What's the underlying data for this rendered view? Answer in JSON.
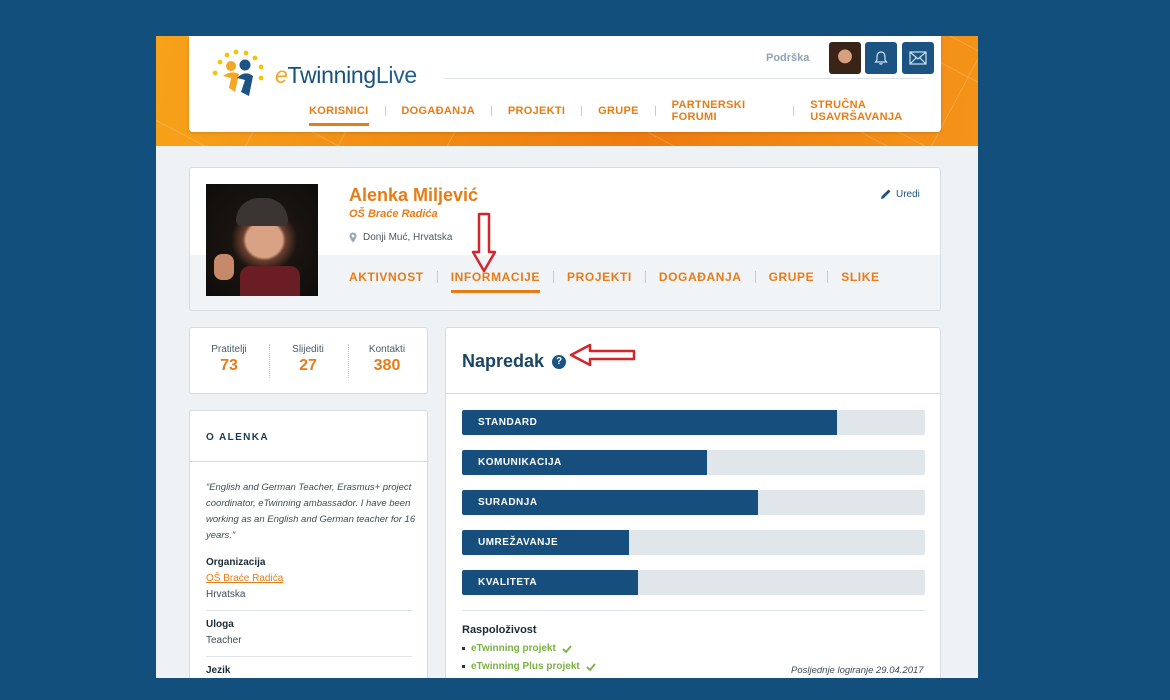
{
  "brand": {
    "logo_e": "e",
    "logo_twinning": "Twinning",
    "logo_live": "Live"
  },
  "header": {
    "support_label": "Podrška",
    "nav": [
      {
        "label": "KORISNICI",
        "active": true
      },
      {
        "label": "DOGAĐANJA"
      },
      {
        "label": "PROJEKTI"
      },
      {
        "label": "GRUPE"
      },
      {
        "label": "PARTNERSKI FORUMI"
      },
      {
        "label": "STRUČNA USAVRŠAVANJA"
      }
    ]
  },
  "profile": {
    "name": "Alenka Miljević",
    "school": "OŠ Braće Radića",
    "location": "Donji Muć, Hrvatska",
    "edit_label": "Uredi",
    "tabs": [
      {
        "label": "AKTIVNOST"
      },
      {
        "label": "INFORMACIJE",
        "active": true
      },
      {
        "label": "PROJEKTI"
      },
      {
        "label": "DOGAĐANJA"
      },
      {
        "label": "GRUPE"
      },
      {
        "label": "SLIKE"
      }
    ]
  },
  "stats": [
    {
      "label": "Pratitelji",
      "value": "73"
    },
    {
      "label": "Slijediti",
      "value": "27"
    },
    {
      "label": "Kontakti",
      "value": "380"
    }
  ],
  "about": {
    "title": "O ALENKA",
    "quote": "“English and German Teacher, Erasmus+ project coordinator, eTwinning ambassador. I have been working as an English and German teacher for 16 years.”",
    "organization_label": "Organizacija",
    "organization_name": "OŠ Braće Radića",
    "organization_country": "Hrvatska",
    "role_label": "Uloga",
    "role_value": "Teacher",
    "language_label": "Jezik"
  },
  "progress": {
    "title": "Napredak",
    "help_glyph": "?",
    "bars": [
      {
        "label": "STANDARD",
        "fraction": 0.81
      },
      {
        "label": "KOMUNIKACIJA",
        "fraction": 0.53
      },
      {
        "label": "SURADNJA",
        "fraction": 0.64
      },
      {
        "label": "UMREŽAVANJE",
        "fraction": 0.36
      },
      {
        "label": "KVALITETA",
        "fraction": 0.38
      }
    ],
    "availability_title": "Raspoloživost",
    "availability": [
      {
        "label": "eTwinning projekt"
      },
      {
        "label": "eTwinning Plus projekt"
      }
    ],
    "last_login": "Posljednje logiranje 29.04.2017"
  },
  "colors": {
    "accent": "#e77c16",
    "navy": "#164f7d",
    "green": "#7bb043",
    "background": "#124f7c"
  }
}
